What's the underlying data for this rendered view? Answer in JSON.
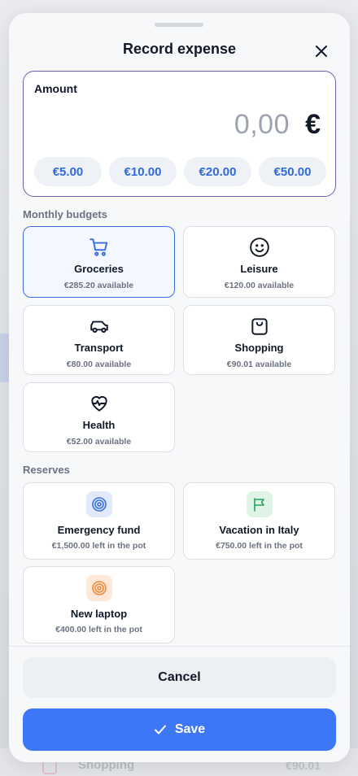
{
  "background": {
    "peek_label": "Shopping",
    "peek_amount": "€90.01"
  },
  "modal": {
    "title": "Record expense",
    "close_icon": "close-icon"
  },
  "amount": {
    "label": "Amount",
    "value": "0,00",
    "currency": "€",
    "quick_chips": [
      "€5.00",
      "€10.00",
      "€20.00",
      "€50.00"
    ]
  },
  "budgets": {
    "section_label": "Monthly budgets",
    "items": [
      {
        "name": "Groceries",
        "available": "€285.20 available",
        "icon": "shopping-cart-icon",
        "selected": true
      },
      {
        "name": "Leisure",
        "available": "€120.00 available",
        "icon": "smiley-icon",
        "selected": false
      },
      {
        "name": "Transport",
        "available": "€80.00 available",
        "icon": "car-icon",
        "selected": false
      },
      {
        "name": "Shopping",
        "available": "€90.01 available",
        "icon": "shopping-bag-icon",
        "selected": false
      },
      {
        "name": "Health",
        "available": "€52.00 available",
        "icon": "heart-pulse-icon",
        "selected": false
      }
    ]
  },
  "reserves": {
    "section_label": "Reserves",
    "items": [
      {
        "name": "Emergency fund",
        "left": "€1,500.00 left in the pot",
        "icon": "target-icon",
        "color": "#3b6fe0"
      },
      {
        "name": "Vacation in Italy",
        "left": "€750.00 left in the pot",
        "icon": "flag-icon",
        "color": "#22a45d"
      },
      {
        "name": "New laptop",
        "left": "€400.00 left in the pot",
        "icon": "target-icon",
        "color": "#f08a3a"
      }
    ]
  },
  "actions": {
    "cancel_label": "Cancel",
    "save_label": "Save"
  },
  "colors": {
    "accent": "#3b77f6",
    "selected_border": "#3b6fe0",
    "amount_border": "#6b5fb0"
  }
}
